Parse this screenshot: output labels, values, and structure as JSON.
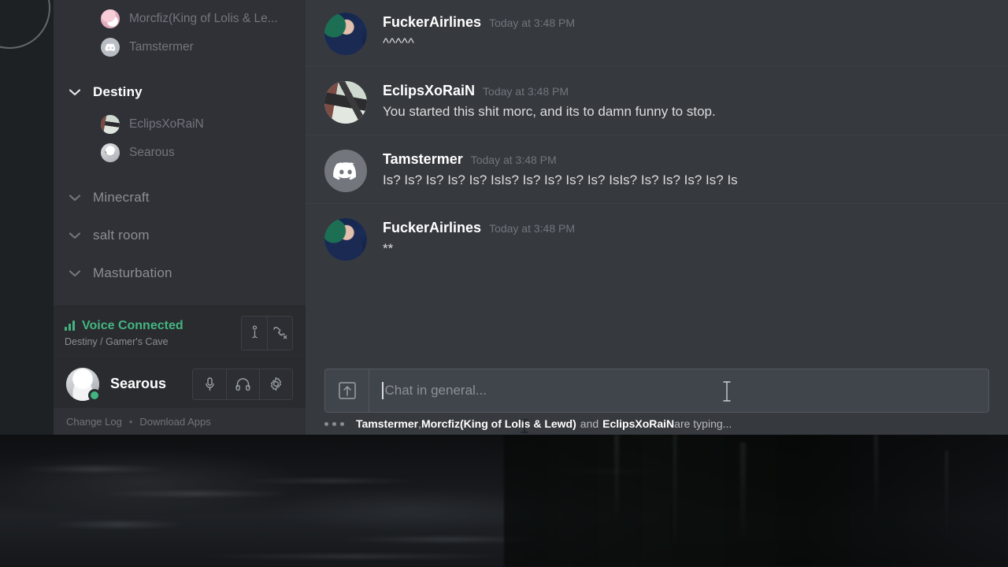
{
  "app": {
    "name": "Discord"
  },
  "colors": {
    "sidebar_bg": "#2f3136",
    "chat_bg": "#36393e",
    "rail_bg": "#1e2124",
    "panel_bg": "#292b2f",
    "accent_green": "#43b581",
    "text_muted": "#72767d",
    "text_normal": "#dcddde",
    "text_white": "#ffffff"
  },
  "sidebar": {
    "voice_members_top": [
      {
        "name": "Morcfiz(King of Lolis & Le...",
        "avatar": "anime-pink-avatar"
      },
      {
        "name": "Tamstermer",
        "avatar": "discord-default-avatar"
      }
    ],
    "categories": [
      {
        "name": "Destiny",
        "expanded": true,
        "active": true,
        "chevron": "chevron-down-icon",
        "members": [
          {
            "name": "EclipsXoRaiN",
            "avatar": "revolver-avatar"
          },
          {
            "name": "Searous",
            "avatar": "anime-white-avatar"
          }
        ]
      },
      {
        "name": "Minecraft",
        "expanded": true,
        "active": false,
        "chevron": "chevron-down-icon",
        "members": []
      },
      {
        "name": "salt room",
        "expanded": true,
        "active": false,
        "chevron": "chevron-down-icon",
        "members": []
      },
      {
        "name": "Masturbation",
        "expanded": true,
        "active": false,
        "chevron": "chevron-down-icon",
        "members": []
      }
    ],
    "voice_panel": {
      "status": "Voice Connected",
      "location": "Destiny / Gamer's Cave",
      "signal_icon": "signal-bars-icon",
      "buttons": [
        {
          "name": "info-icon",
          "label": ""
        },
        {
          "name": "phone-hangup-icon",
          "label": ""
        }
      ]
    },
    "user_panel": {
      "username": "Searous",
      "avatar": "anime-white-avatar",
      "presence": "online",
      "buttons": [
        {
          "name": "microphone-icon"
        },
        {
          "name": "headphones-icon"
        },
        {
          "name": "gear-icon"
        }
      ]
    },
    "footer": {
      "change_log": "Change Log",
      "separator": "•",
      "download_apps": "Download Apps"
    }
  },
  "chat": {
    "messages": [
      {
        "author": "FuckerAirlines",
        "timestamp": "Today at 3:48 PM",
        "text": "^^^^^",
        "avatar": "woman-dark-hair-avatar"
      },
      {
        "author": "EclipsXoRaiN",
        "timestamp": "Today at 3:48 PM",
        "text": "You started this shit morc, and its to damn funny to stop.",
        "avatar": "revolver-avatar"
      },
      {
        "author": "Tamstermer",
        "timestamp": "Today at 3:48 PM",
        "text": "Is? Is? Is? Is? Is? IsIs? Is? Is? Is? Is? IsIs? Is? Is? Is? Is? Is",
        "avatar": "discord-default-avatar"
      },
      {
        "author": "FuckerAirlines",
        "timestamp": "Today at 3:48 PM",
        "text": "**",
        "avatar": "woman-dark-hair-avatar"
      }
    ],
    "composer": {
      "placeholder": "Chat in general...",
      "value": "",
      "upload_icon": "upload-arrow-icon"
    },
    "typing_indicator": {
      "user_1": "Tamstermer",
      "comma": ", ",
      "user_2": "Morcfiz(King of Lolis & Lewd)",
      "conjunction": "and",
      "user_3": "EclipsXoRaiN",
      "tail": " are typing..."
    }
  }
}
